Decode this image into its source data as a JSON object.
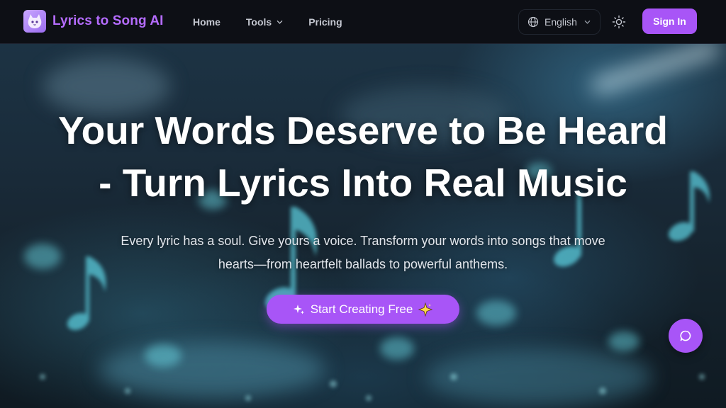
{
  "brand": {
    "name": "Lyrics to Song AI",
    "logo_icon": "cat-logo-icon",
    "accent": "#a855f7",
    "name_color": "#b56cff"
  },
  "nav": {
    "home": "Home",
    "tools": "Tools",
    "pricing": "Pricing",
    "language": "English",
    "theme_icon": "sun-icon",
    "sign_in": "Sign In"
  },
  "hero": {
    "headline_line1": "Your Words Deserve to Be Heard",
    "headline_line2": "- Turn Lyrics Into Real Music",
    "sub_line1": "Every lyric has a soul. Give yours a voice. Transform your words into songs that move",
    "sub_line2": "hearts—from heartfelt ballads to powerful anthems.",
    "cta_label": "Start Creating Free",
    "cta_icons": [
      "sparkles-icon",
      "sparkle-star-icon"
    ]
  },
  "chat": {
    "icon": "chat-bubble-icon"
  }
}
